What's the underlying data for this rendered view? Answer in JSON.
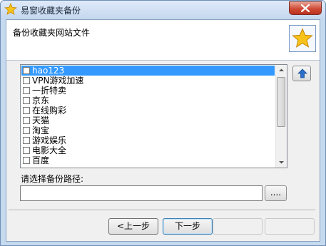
{
  "window": {
    "title": "易窗收藏夹备份"
  },
  "header": {
    "title": "备份收藏夹网站文件"
  },
  "list": {
    "items": [
      {
        "label": "hao123",
        "selected": true
      },
      {
        "label": "VPN游戏加速",
        "selected": false
      },
      {
        "label": "一折特卖",
        "selected": false
      },
      {
        "label": "京东",
        "selected": false
      },
      {
        "label": "在线购彩",
        "selected": false
      },
      {
        "label": "天猫",
        "selected": false
      },
      {
        "label": "淘宝",
        "selected": false
      },
      {
        "label": "游戏娱乐",
        "selected": false
      },
      {
        "label": "电影大全",
        "selected": false
      },
      {
        "label": "百度",
        "selected": false
      }
    ]
  },
  "path": {
    "label": "请选择备份路径:",
    "value": "",
    "browse_label": "...."
  },
  "buttons": {
    "prev_label": "<上一步",
    "next_label": "下一步",
    "btn3_label": "",
    "btn4_label": ""
  },
  "colors": {
    "selection": "#3399ff",
    "close": "#cf4a35",
    "titlebar": "#c4d7ee"
  }
}
